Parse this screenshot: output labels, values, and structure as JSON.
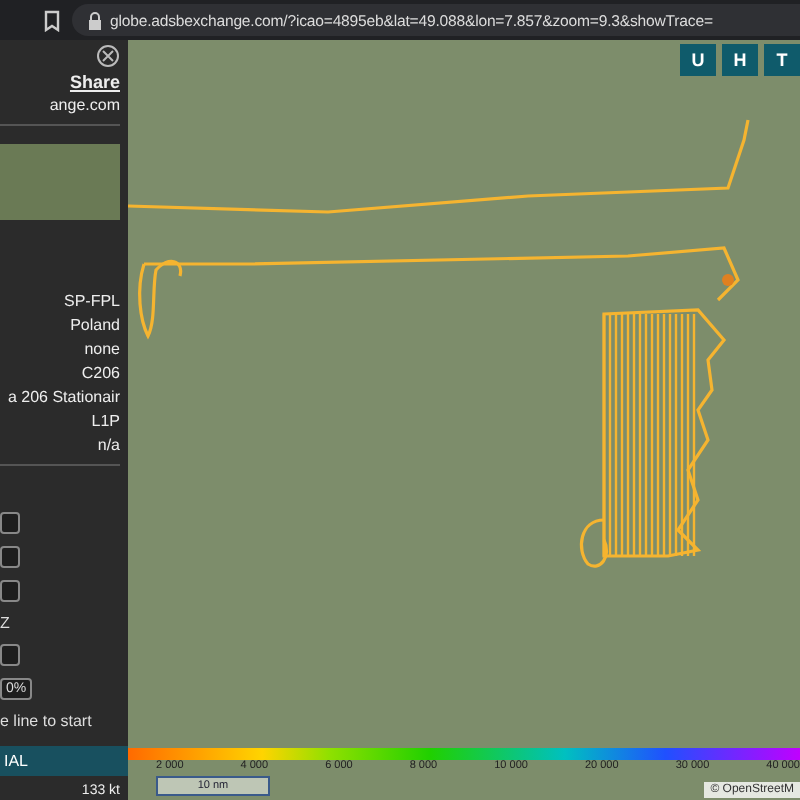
{
  "browser": {
    "url": "globe.adsbexchange.com/?icao=4895eb&lat=49.088&lon=7.857&zoom=9.3&showTrace="
  },
  "sidebar": {
    "share_label": "Share",
    "site_text": "ange.com",
    "details": [
      "SP-FPL",
      "Poland",
      "none",
      "C206",
      "a 206 Stationair",
      "L1P",
      "n/a"
    ],
    "controls": [
      {
        "kind": "button"
      },
      {
        "kind": "button"
      },
      {
        "kind": "button"
      },
      {
        "kind": "text",
        "label": "Z"
      },
      {
        "kind": "button"
      },
      {
        "kind": "button",
        "label": "0%"
      },
      {
        "kind": "text",
        "label": "e line to start"
      }
    ],
    "status_bar": "IAL",
    "speed": "133 kt"
  },
  "map": {
    "mode_buttons": [
      "U",
      "H",
      "T"
    ],
    "altitude_labels": [
      "2 000",
      "4 000",
      "6 000",
      "8 000",
      "10 000",
      "20 000",
      "30 000",
      "40 000"
    ],
    "scale_bar": "10 nm",
    "attribution": "© OpenStreetM"
  }
}
